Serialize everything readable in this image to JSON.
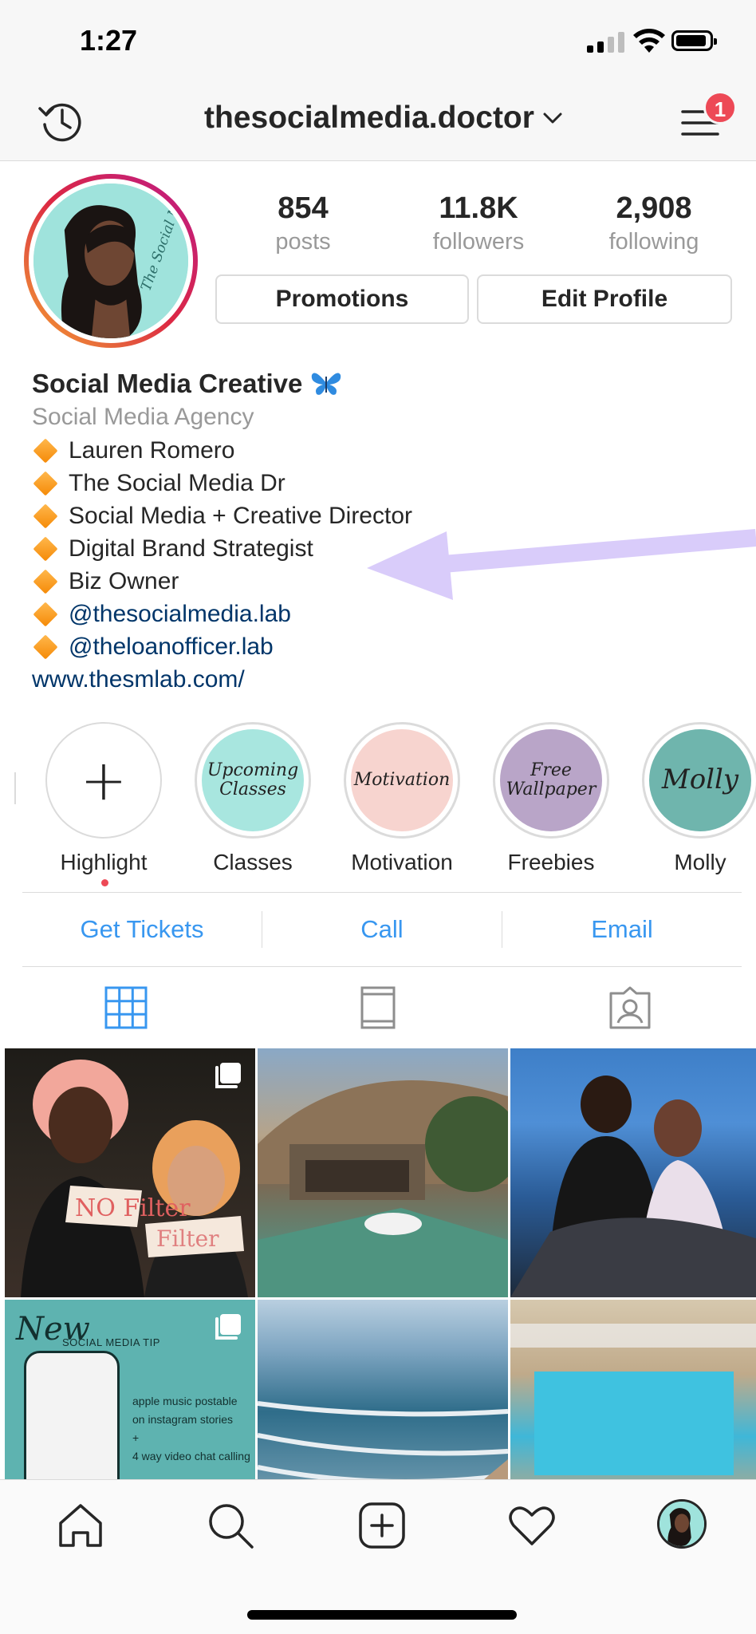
{
  "status_bar": {
    "time": "1:27"
  },
  "top_nav": {
    "username": "thesocialmedia.doctor",
    "notification_count": "1"
  },
  "profile": {
    "stats": [
      {
        "value": "854",
        "label": "posts"
      },
      {
        "value": "11.8K",
        "label": "followers"
      },
      {
        "value": "2,908",
        "label": "following"
      }
    ],
    "promotions_label": "Promotions",
    "edit_profile_label": "Edit Profile"
  },
  "bio": {
    "name": "Social Media Creative",
    "name_emoji": "butterfly-emoji",
    "category": "Social Media Agency",
    "lines": [
      {
        "text": " Lauren Romero",
        "is_link": false
      },
      {
        "text": "The Social Media Dr",
        "is_link": false
      },
      {
        "text": "Social Media + Creative Director",
        "is_link": false
      },
      {
        "text": "Digital Brand Strategist",
        "is_link": false
      },
      {
        "text": "Biz Owner",
        "is_link": false
      },
      {
        "text": "@thesocialmedia.lab",
        "is_link": true
      },
      {
        "text": "@theloanofficer.lab",
        "is_link": true
      }
    ],
    "website": "www.thesmlab.com/"
  },
  "highlights": [
    {
      "label": "Highlight",
      "cover_text": "+",
      "color": "#ffffff"
    },
    {
      "label": "Classes",
      "cover_text": "Upcoming Classes",
      "color": "#a8e6df"
    },
    {
      "label": "Motivation",
      "cover_text": "Motivation",
      "color": "#f7d4cf"
    },
    {
      "label": "Freebies",
      "cover_text": "Free Wallpaper",
      "color": "#b9a5c8"
    },
    {
      "label": "Molly",
      "cover_text": "Molly",
      "color": "#6fb5ad"
    }
  ],
  "actions": [
    {
      "label": "Get Tickets"
    },
    {
      "label": "Call"
    },
    {
      "label": "Email"
    }
  ],
  "grid_posts": [
    {
      "overlay_text": [
        "NO Filter",
        "Filter"
      ],
      "multi": true
    },
    {
      "overlay_text": [],
      "multi": false
    },
    {
      "overlay_text": [],
      "multi": false
    },
    {
      "overlay_text": [
        "New",
        "SOCIAL MEDIA TIP",
        "apple music postable on instagram stories",
        "+",
        "4 way video chat calling"
      ],
      "multi": true
    },
    {
      "overlay_text": [],
      "multi": false
    },
    {
      "overlay_text": [],
      "multi": false
    }
  ],
  "colors": {
    "link_blue": "#3897f0",
    "bio_link": "#003569",
    "badge_red": "#ed4956",
    "arrow_purple": "#d9ccfa"
  }
}
